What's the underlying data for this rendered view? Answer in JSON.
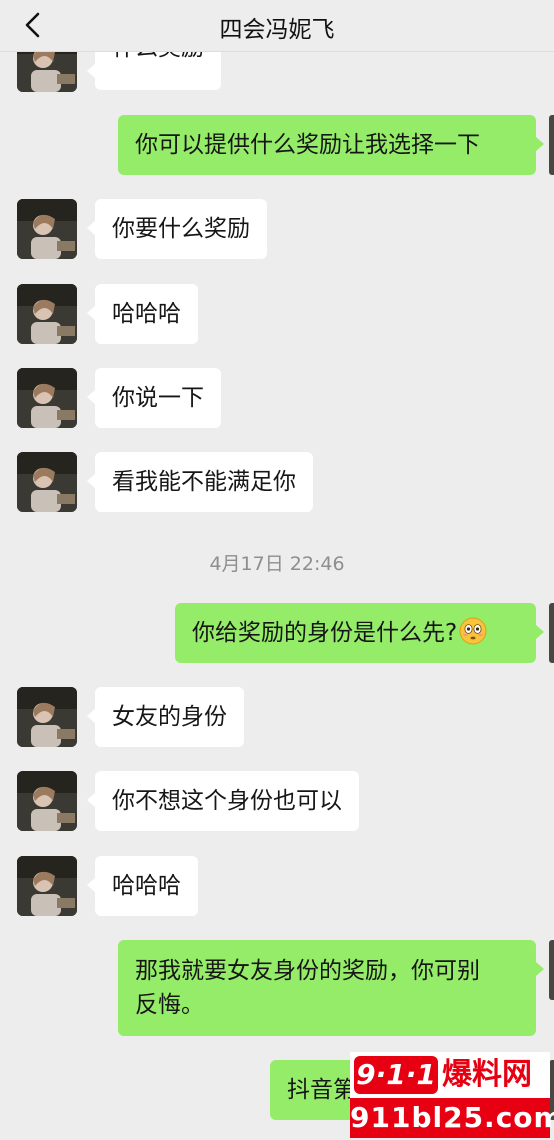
{
  "header": {
    "title": "四会冯妮飞",
    "back_icon": "chevron-left-icon"
  },
  "messages": [
    {
      "side": "left",
      "text": "什么奖励"
    },
    {
      "side": "right",
      "text": "你可以提供什么奖励让我选择一下"
    },
    {
      "side": "left",
      "text": "你要什么奖励"
    },
    {
      "side": "left",
      "text": "哈哈哈"
    },
    {
      "side": "left",
      "text": "你说一下"
    },
    {
      "side": "left",
      "text": "看我能不能满足你"
    },
    {
      "side": "right",
      "text": "你给奖励的身份是什么先?",
      "emoji": "flushed-face-emoji"
    },
    {
      "side": "left",
      "text": "女友的身份"
    },
    {
      "side": "left",
      "text": "你不想这个身份也可以"
    },
    {
      "side": "left",
      "text": "哈哈哈"
    },
    {
      "side": "right",
      "line1": "那我就要女友身份的奖励，你可别",
      "line2": "反悔。"
    },
    {
      "side": "right",
      "text": "抖音第一次 哈哈哈"
    }
  ],
  "timestamp": "4月17日 22:46",
  "watermark": {
    "badge": "9·1·1",
    "brand": "爆料网",
    "domain": "911bl25.com"
  },
  "colors": {
    "background": "#ededed",
    "self_bubble": "#95ec69",
    "other_bubble": "#ffffff",
    "watermark_red": "#e60012"
  }
}
